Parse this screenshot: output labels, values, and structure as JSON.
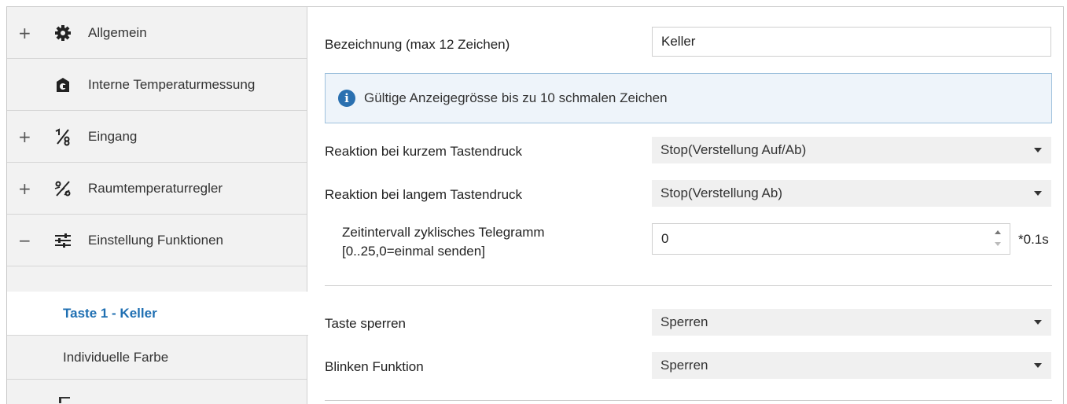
{
  "sidebar": {
    "items": [
      {
        "expander": "+",
        "icon": "gear-icon",
        "label": "Allgemein"
      },
      {
        "expander": "",
        "icon": "thermometer-box-icon",
        "label": "Interne Temperaturmessung"
      },
      {
        "expander": "+",
        "icon": "input-percent-icon",
        "label": "Eingang"
      },
      {
        "expander": "+",
        "icon": "room-controller-icon",
        "label": "Raumtemperaturregler"
      },
      {
        "expander": "−",
        "icon": "sliders-icon",
        "label": "Einstellung Funktionen"
      }
    ],
    "subitems": [
      {
        "label": "Taste 1 - Keller",
        "active": true
      },
      {
        "label": "Individuelle Farbe",
        "active": false
      }
    ]
  },
  "form": {
    "name_label": "Bezeichnung (max 12 Zeichen)",
    "name_value": "Keller",
    "info_text": "Gültige Anzeigegrösse bis zu 10 schmalen Zeichen",
    "short_press_label": "Reaktion bei kurzem Tastendruck",
    "short_press_value": "Stop(Verstellung Auf/Ab)",
    "long_press_label": "Reaktion bei langem Tastendruck",
    "long_press_value": "Stop(Verstellung Ab)",
    "interval_label_line1": "Zeitintervall zyklisches Telegramm",
    "interval_label_line2": "[0..25,0=einmal senden]",
    "interval_value": "0",
    "interval_unit": "*0.1s",
    "lock_label": "Taste sperren",
    "lock_value": "Sperren",
    "blink_label": "Blinken Funktion",
    "blink_value": "Sperren"
  },
  "colors": {
    "accent": "#1f6fb2",
    "info_icon": "#2a70b0",
    "info_bg": "#eef4fa",
    "info_border": "#9fc1dd",
    "sidebar_bg": "#f2f2f2"
  }
}
